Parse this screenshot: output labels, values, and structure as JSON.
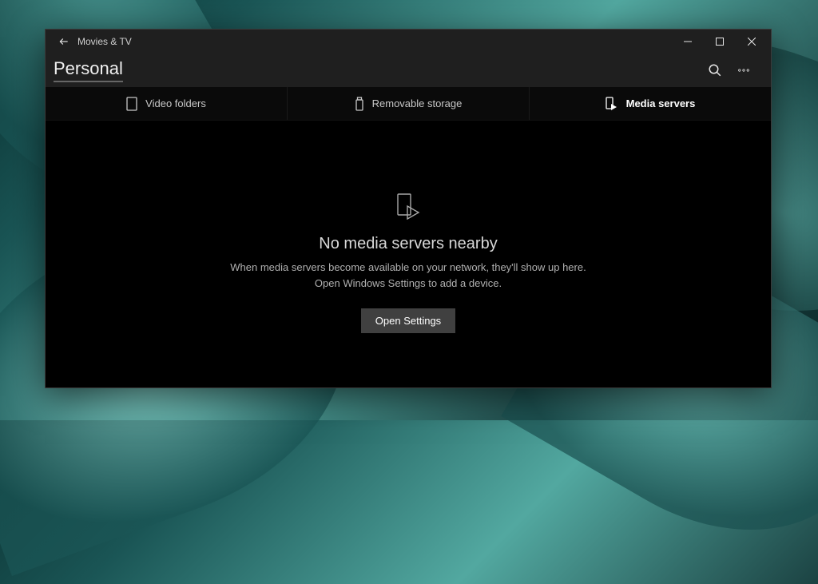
{
  "titlebar": {
    "app_name": "Movies & TV"
  },
  "header": {
    "page_title": "Personal"
  },
  "tabs": [
    {
      "label": "Video folders"
    },
    {
      "label": "Removable storage"
    },
    {
      "label": "Media servers"
    }
  ],
  "empty_state": {
    "heading": "No media servers nearby",
    "line1": "When media servers become available on your network, they'll show up here.",
    "line2": "Open Windows Settings to add a device.",
    "button_label": "Open Settings"
  }
}
